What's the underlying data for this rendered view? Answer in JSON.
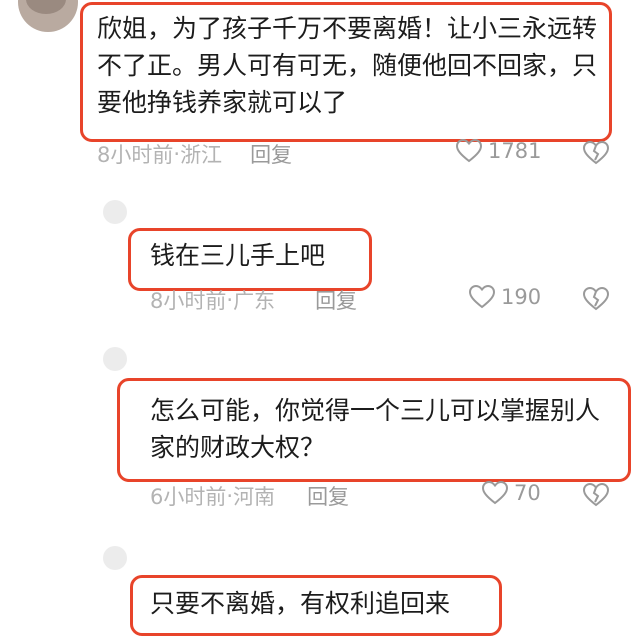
{
  "comments": [
    {
      "text": "欣姐，为了孩子千万不要离婚！让小三永远转不了正。男人可有可无，随便他回不回家，只要他挣钱养家就可以了",
      "time": "8小时前",
      "location": "浙江",
      "reply": "回复",
      "likes": "1781"
    },
    {
      "text": "钱在三儿手上吧",
      "time": "8小时前",
      "location": "广东",
      "reply": "回复",
      "likes": "190"
    },
    {
      "text": "怎么可能，你觉得一个三儿可以掌握别人家的财政大权？",
      "time": "6小时前",
      "location": "河南",
      "reply": "回复",
      "likes": "70"
    },
    {
      "text": "只要不离婚，有权利追回来"
    }
  ],
  "colors": {
    "highlight": "#e8442a",
    "meta": "#b3b3b3"
  }
}
